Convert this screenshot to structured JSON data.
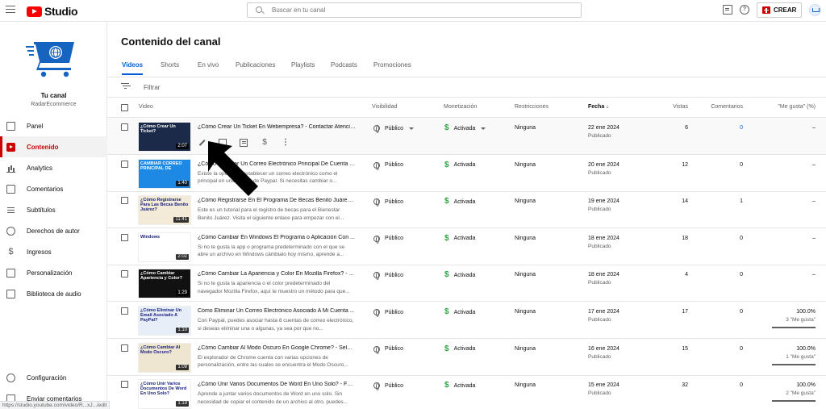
{
  "app": {
    "title": "Studio",
    "brand_color": "#ff0000",
    "accent": "#065fd4"
  },
  "topbar": {
    "search_placeholder": "Buscar en tu canal",
    "create_label": "CREAR",
    "help_glyph": "?"
  },
  "sidebar": {
    "channel_name": "Tu canal",
    "channel_handle": "RadarEcommerce",
    "items": [
      {
        "label": "Panel",
        "icon": "dashboard-icon"
      },
      {
        "label": "Contenido",
        "icon": "content-icon",
        "active": true
      },
      {
        "label": "Analytics",
        "icon": "analytics-icon"
      },
      {
        "label": "Comentarios",
        "icon": "comments-icon"
      },
      {
        "label": "Subtítulos",
        "icon": "subtitles-icon"
      },
      {
        "label": "Derechos de autor",
        "icon": "copyright-icon"
      },
      {
        "label": "Ingresos",
        "icon": "earn-icon"
      },
      {
        "label": "Personalización",
        "icon": "customization-icon"
      },
      {
        "label": "Biblioteca de audio",
        "icon": "audio-library-icon"
      }
    ],
    "bottom_items": [
      {
        "label": "Configuración",
        "icon": "settings-icon"
      },
      {
        "label": "Enviar comentarios",
        "icon": "feedback-icon"
      }
    ]
  },
  "main": {
    "title": "Contenido del canal",
    "tabs": [
      "Videos",
      "Shorts",
      "En vivo",
      "Publicaciones",
      "Playlists",
      "Podcasts",
      "Promociones"
    ],
    "filter_label": "Filtrar",
    "columns": {
      "video": "Video",
      "visibility": "Visibilidad",
      "monetization": "Monetización",
      "restrictions": "Restricciones",
      "date": "Fecha",
      "views": "Vistas",
      "comments": "Comentarios",
      "likes": "\"Me gusta\" (%)"
    },
    "rows": [
      {
        "title": "¿Cómo Crear Un Ticket En Webempresa? - Contactar Atenció...",
        "description": "",
        "thumb_text": "¿Cómo Crear Un Ticket?",
        "thumb_bg": "#1c2a4a",
        "duration": "2:07",
        "visibility": "Público",
        "monetization": "Activada",
        "restrictions": "Ninguna",
        "date": "22 ene 2024",
        "status": "Publicado",
        "views": "6",
        "comments": "0",
        "likes": "–",
        "likes_sub": "",
        "likes_fraction": 0
      },
      {
        "title": "¿Cómo Cambiar Un Correo Electrónico Principal De Cuenta P...",
        "description": "Existe la opción de establecer un correo electrónico como el principal en una cuenta de Paypal. Si necesitas cambiar o...",
        "thumb_text": "CAMBIAR CORREO PRINCIPAL DE",
        "thumb_bg": "#1e88e5",
        "duration": "1:40",
        "visibility": "Público",
        "monetization": "Activada",
        "restrictions": "Ninguna",
        "date": "20 ene 2024",
        "status": "Publicado",
        "views": "12",
        "comments": "0",
        "likes": "–",
        "likes_sub": "",
        "likes_fraction": 0
      },
      {
        "title": "¿Cómo Registrarse En El Programa De Becas Benito Juárez? ...",
        "description": "Este es un tutorial para el registro de becas para el Bienestar Benito Juárez. Visita el siguiente enlace para empezar con el...",
        "thumb_text": "¿Cómo Registrarse Para Las Becas Benito Juárez?",
        "thumb_bg": "#f3ead7",
        "duration": "11:41",
        "visibility": "Público",
        "monetization": "Activada",
        "restrictions": "Ninguna",
        "date": "19 ene 2024",
        "status": "Publicado",
        "views": "14",
        "comments": "1",
        "likes": "–",
        "likes_sub": "",
        "likes_fraction": 0
      },
      {
        "title": "¿Cómo Cambiar En Windows El Programa o Aplicación Con ...",
        "description": "Si no te gusta la app o programa predeterminado con el que se abre un archivo en Windows cámbialo hoy mismo, aprende a...",
        "thumb_text": "Windows",
        "thumb_bg": "#ffffff",
        "duration": "2:02",
        "visibility": "Público",
        "monetization": "Activada",
        "restrictions": "Ninguna",
        "date": "18 ene 2024",
        "status": "Publicado",
        "views": "18",
        "comments": "0",
        "likes": "–",
        "likes_sub": "",
        "likes_fraction": 0
      },
      {
        "title": "¿Cómo Cambiar La Apariencia y Color En Mozilla Firefox? - ...",
        "description": "Si no te gusta la apariencia o el color predeterminado del navegador Mozilla Firefox, aquí te muestro un método para que...",
        "thumb_text": "¿Cómo Cambiar Apariencia y Color?",
        "thumb_bg": "#111111",
        "duration": "1:29",
        "visibility": "Público",
        "monetization": "Activada",
        "restrictions": "Ninguna",
        "date": "18 ene 2024",
        "status": "Publicado",
        "views": "4",
        "comments": "0",
        "likes": "–",
        "likes_sub": "",
        "likes_fraction": 0
      },
      {
        "title": "Cómo Eliminar Un Correo Electrónico Asociado A Mi Cuenta ...",
        "description": "Con Paypal, puedes asociar hasta 8 cuentas de correo electrónico, si deseas eliminar una o algunas, ya sea por que no...",
        "thumb_text": "¿Cómo Eliminar Un Email Asociado A PayPal?",
        "thumb_bg": "#e8eef8",
        "duration": "1:10",
        "visibility": "Público",
        "monetization": "Activada",
        "restrictions": "Ninguna",
        "date": "17 ene 2024",
        "status": "Publicado",
        "views": "17",
        "comments": "0",
        "likes": "100.0%",
        "likes_sub": "3 \"Me gusta\"",
        "likes_fraction": 1
      },
      {
        "title": "¿Cómo Cambiar Al Modo Oscuro En Google Chrome? - Selec...",
        "description": "El explorador de Chrome cuenta con varias opciones de personalización, entre las cuales se encuentra el Modo Oscuro...",
        "thumb_text": "¿Cómo Cambiar Al Modo Oscuro?",
        "thumb_bg": "#efe6d2",
        "duration": "1:09",
        "visibility": "Público",
        "monetization": "Activada",
        "restrictions": "Ninguna",
        "date": "16 ene 2024",
        "status": "Publicado",
        "views": "15",
        "comments": "0",
        "likes": "100.0%",
        "likes_sub": "1 \"Me gusta\"",
        "likes_fraction": 1
      },
      {
        "title": "¿Cómo Unir Varios Documentos De Word En Uno Solo? - Fusi...",
        "description": "Aprende a juntar varios documentos de Word en uno solo. Sin necesidad de copiar el contenido de un archivo al otro, puedes...",
        "thumb_text": "¿Cómo Unir Varios Documentos De Word En Uno Solo?",
        "thumb_bg": "#ffffff",
        "duration": "1:19",
        "visibility": "Público",
        "monetization": "Activada",
        "restrictions": "Ninguna",
        "date": "15 ene 2024",
        "status": "Publicado",
        "views": "32",
        "comments": "0",
        "likes": "100.0%",
        "likes_sub": "2 \"Me gusta\"",
        "likes_fraction": 1
      }
    ]
  },
  "statusbar": {
    "url": "https://studio.youtube.com/video/R...xJ.../edit"
  }
}
